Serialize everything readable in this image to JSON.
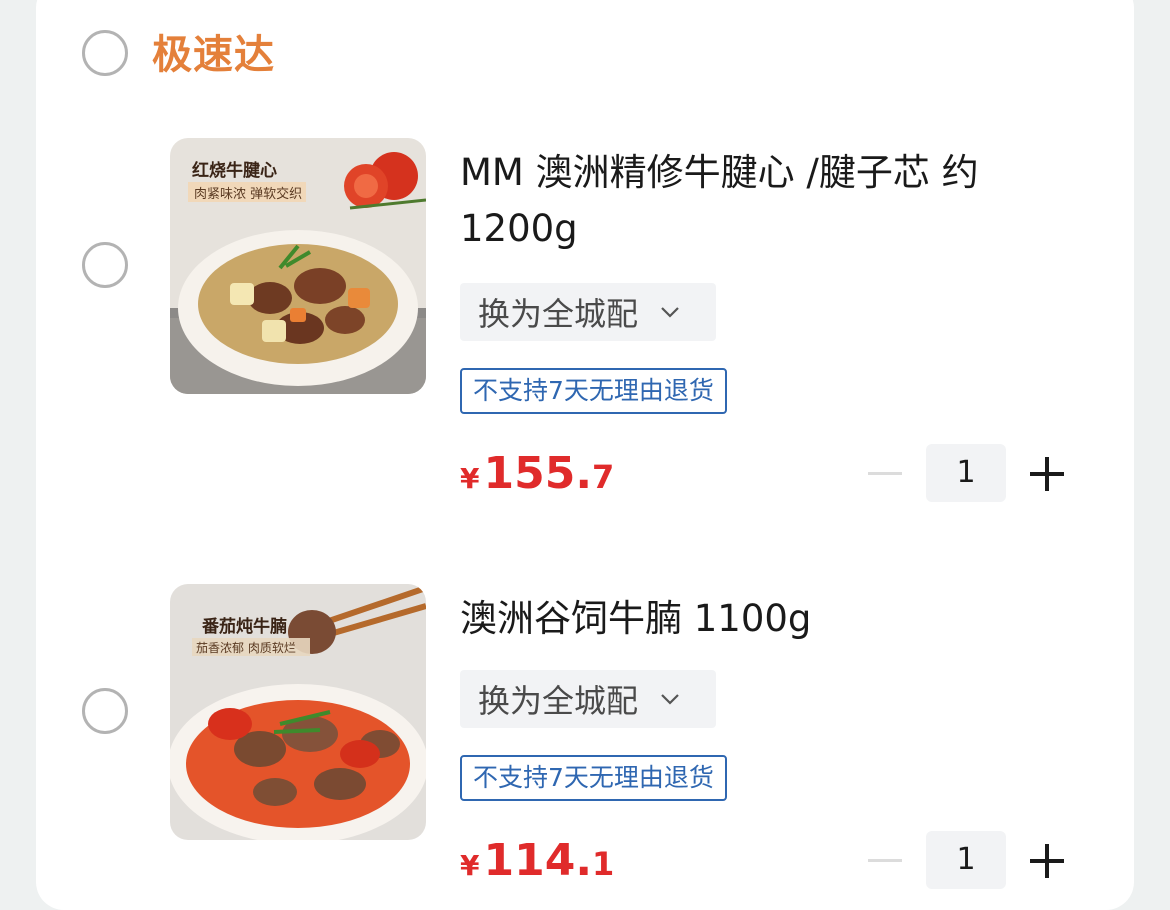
{
  "section": {
    "title": "极速达"
  },
  "items": [
    {
      "title": "MM 澳洲精修牛腱心 /腱子芯 约 1200g",
      "image_caption": "红烧牛腱心",
      "image_subcaption": "肉紧味浓 弹软交织",
      "switch_label": "换为全城配",
      "policy_tag": "不支持7天无理由退货",
      "price_symbol": "¥",
      "price_int": "155.",
      "price_dec": "7",
      "quantity": "1"
    },
    {
      "title": "澳洲谷饲牛腩 1100g",
      "image_caption": "番茄炖牛腩",
      "image_subcaption": "茄香浓郁 肉质软烂",
      "switch_label": "换为全城配",
      "policy_tag": "不支持7天无理由退货",
      "price_symbol": "¥",
      "price_int": "114.",
      "price_dec": "1",
      "quantity": "1"
    }
  ],
  "icons": {
    "dropdown": "chevron-down-icon",
    "decrease": "minus-icon",
    "increase": "plus-icon"
  },
  "colors": {
    "section_title": "#e4803a",
    "price": "#e02b2b",
    "policy_tag": "#2f67b1"
  }
}
